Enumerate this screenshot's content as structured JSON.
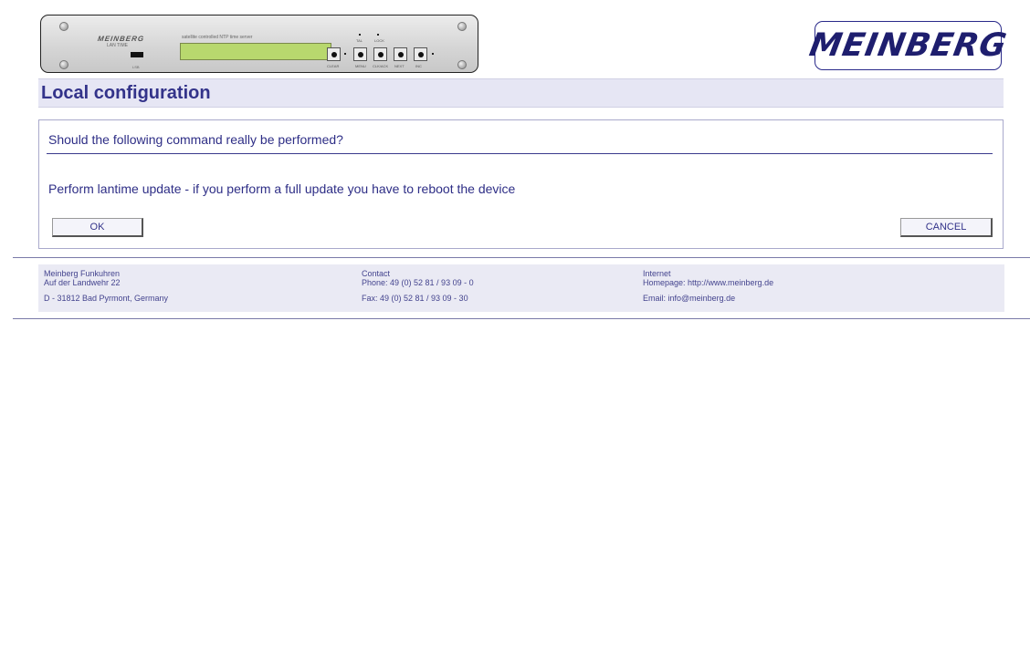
{
  "device_image": {
    "brand": "MEINBERG",
    "model": "LAN TIME",
    "subtitle": "satellite controlled NTP time server",
    "caption": "LSB",
    "led_labels": [
      "TAL",
      "LOCK"
    ],
    "button_labels": [
      "CLEAR",
      "MENU",
      "CLK/ACK",
      "NEXT",
      "INC"
    ]
  },
  "logo": {
    "text": "MEINBERG"
  },
  "page": {
    "title": "Local configuration"
  },
  "dialog": {
    "question": "Should the following command really be performed?",
    "command": "Perform lantime update - if you perform a full update you have to reboot the device",
    "ok_label": "OK",
    "cancel_label": "CANCEL"
  },
  "footer": {
    "company": {
      "name": "Meinberg Funkuhren",
      "street": "Auf der Landwehr 22",
      "city": "D - 31812 Bad Pyrmont, Germany"
    },
    "contact": {
      "heading": "Contact",
      "phone": "Phone: 49 (0) 52 81 / 93 09 - 0",
      "fax": "Fax: 49 (0) 52 81 / 93 09 - 30"
    },
    "internet": {
      "heading": "Internet",
      "homepage": "Homepage: http://www.meinberg.de",
      "email": "Email: info@meinberg.de"
    }
  }
}
